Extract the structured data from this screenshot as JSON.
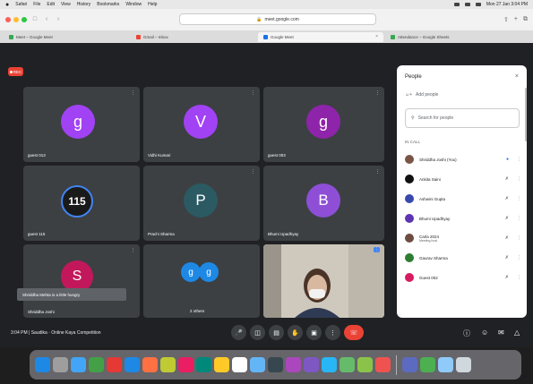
{
  "menubar": {
    "apple": "",
    "items": [
      "Safari",
      "File",
      "Edit",
      "View",
      "History",
      "Bookmarks",
      "Window",
      "Help"
    ],
    "clock": "Mon 27 Jan 3:04 PM"
  },
  "browser": {
    "url": "meet.google.com",
    "tabs": [
      {
        "label": "Meet – Google Meet",
        "color": "#34a853"
      },
      {
        "label": "Gmail – Inbox",
        "color": "#ea4335"
      },
      {
        "label": "Google Meet",
        "color": "#1a73e8",
        "active": true
      },
      {
        "label": "Attendance – Google Sheets",
        "color": "#34a853"
      }
    ]
  },
  "meet": {
    "rec_label": "REC",
    "tiles": [
      {
        "letter": "g",
        "label": "guest 013",
        "color": "#a142f4"
      },
      {
        "letter": "V",
        "label": "Vidhi Kumari",
        "color": "#a142f4"
      },
      {
        "letter": "g",
        "label": "guest 003",
        "color": "#8e24aa"
      },
      {
        "letter": "115",
        "label": "guest 115",
        "color": "#1a1a1a"
      },
      {
        "letter": "P",
        "label": "Prachi Sharma",
        "color": "#2b5a63"
      },
      {
        "letter": "B",
        "label": "Bhumi Upadhyay",
        "color": "#8e4fd6"
      },
      {
        "letter": "S",
        "label": "",
        "color": "#c2185b"
      },
      {
        "letter": "g",
        "label": "2 others",
        "color": "#1e88e5"
      },
      {
        "letter": "",
        "label": "",
        "color": ""
      }
    ],
    "tooltip": "Shriddha Mehta is a little hungry",
    "self_name": "Shriddha Joshi",
    "time_label": "3:04 PM | Saudika · Online Kaya Competition",
    "controls": [
      "mic",
      "cam",
      "cc",
      "hand",
      "present",
      "more",
      "end"
    ],
    "right_controls": [
      "info",
      "people",
      "chat",
      "activities"
    ]
  },
  "people_panel": {
    "title": "People",
    "add_label": "Add people",
    "search_placeholder": "Search for people",
    "in_meeting_label": "IN CALL",
    "participants": [
      {
        "name": "Shriddha Joshi (You)",
        "sub": "",
        "color": "#795548"
      },
      {
        "name": "Ankita Saini",
        "sub": "",
        "color": "#111111"
      },
      {
        "name": "Ashwini Gupta",
        "sub": "",
        "color": "#3949ab"
      },
      {
        "name": "Bhumi Upadhyay",
        "sub": "",
        "color": "#5e35b1"
      },
      {
        "name": "Carla 2024",
        "sub": "Meeting host",
        "color": "#6d4c41"
      },
      {
        "name": "Gaurav Sharma",
        "sub": "",
        "color": "#2e7d32"
      },
      {
        "name": "Guest 002",
        "sub": "",
        "color": "#d81b60"
      }
    ]
  },
  "dock_colors": [
    "#1e88e5",
    "#9e9e9e",
    "#42a5f5",
    "#43a047",
    "#e53935",
    "#1e88e5",
    "#ff7043",
    "#c0ca33",
    "#e91e63",
    "#00897b",
    "#ffca28",
    "#ffffff",
    "#64b5f6",
    "#37474f",
    "#ab47bc",
    "#7e57c2",
    "#29b6f6",
    "#66bb6a",
    "#8bc34a",
    "#ef5350",
    "#5c6bc0",
    "#4caf50",
    "#90caf9",
    "#cfd8dc"
  ]
}
